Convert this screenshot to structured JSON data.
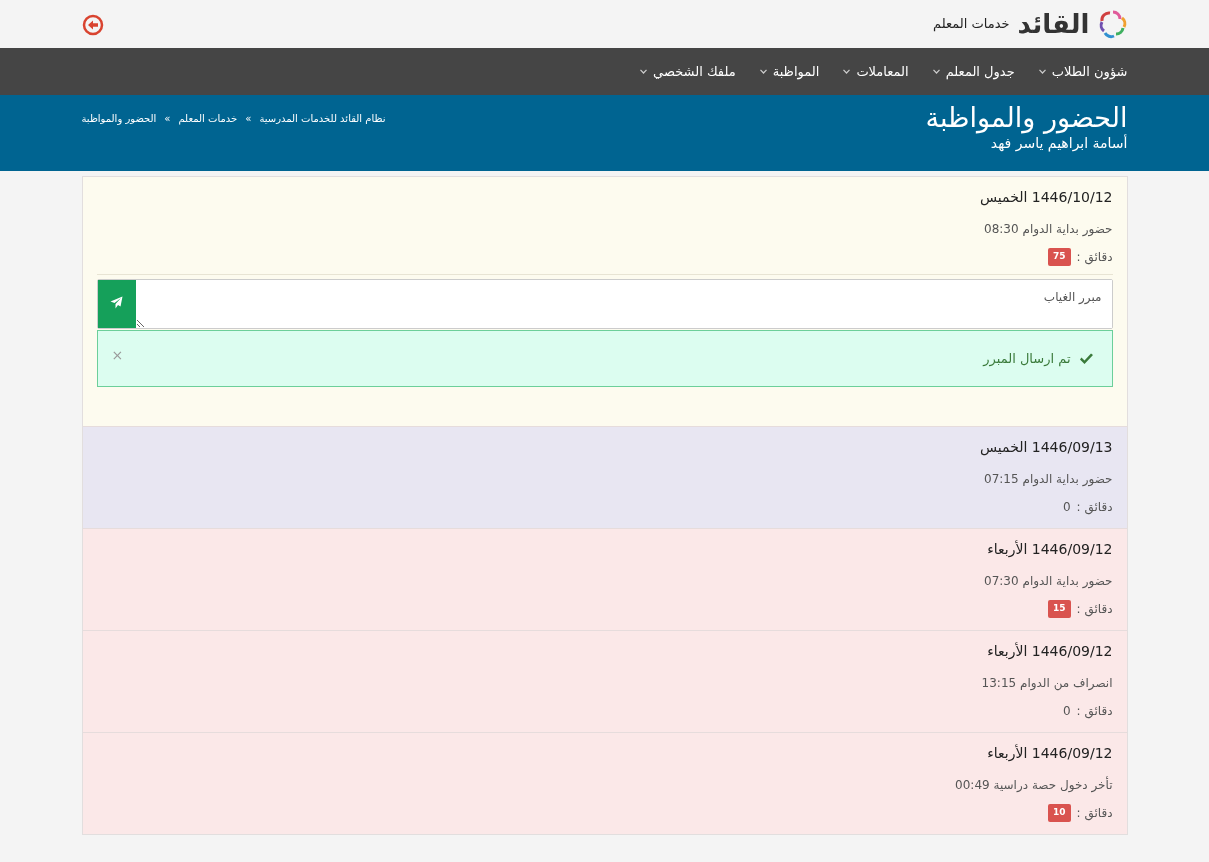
{
  "brand": {
    "name": "القائد",
    "subtitle": "خدمات المعلم"
  },
  "nav": [
    {
      "label": "شؤون الطلاب"
    },
    {
      "label": "جدول المعلم"
    },
    {
      "label": "المعاملات"
    },
    {
      "label": "المواظبة"
    },
    {
      "label": "ملفك الشخصي"
    }
  ],
  "page_header": {
    "title": "الحضور والمواظبة",
    "user": "أسامة ابراهيم ياسر فهد",
    "breadcrumb_separator": "»",
    "breadcrumb": [
      "نظام القائد للخدمات المدرسية",
      "خدمات المعلم",
      "الحضور والمواظبة"
    ]
  },
  "records": [
    {
      "title": "1446/10/12 الخميس",
      "event": "حضور بداية الدوام 08:30",
      "minutes_label": "دقائق :",
      "minutes": "75",
      "late": true,
      "color": "#fdfbef",
      "excuse": {
        "placeholder": "مبرر الغياب",
        "alert": "تم ارسال المبرر",
        "close": "×"
      }
    },
    {
      "title": "1446/09/13 الخميس",
      "event": "حضور بداية الدوام 07:15",
      "minutes_label": "دقائق :",
      "minutes": "0",
      "late": false,
      "color": "#e8e6f2"
    },
    {
      "title": "1446/09/12 الأربعاء",
      "event": "حضور بداية الدوام 07:30",
      "minutes_label": "دقائق :",
      "minutes": "15",
      "late": true,
      "color": "#fbe8e8"
    },
    {
      "title": "1446/09/12 الأربعاء",
      "event": "انصراف من الدوام 13:15",
      "minutes_label": "دقائق :",
      "minutes": "0",
      "late": false,
      "color": "#fbe8e8"
    },
    {
      "title": "1446/09/12 الأربعاء",
      "event": "تأخر دخول حصة دراسية 00:49",
      "minutes_label": "دقائق :",
      "minutes": "10",
      "late": true,
      "color": "#fbe8e8"
    }
  ]
}
